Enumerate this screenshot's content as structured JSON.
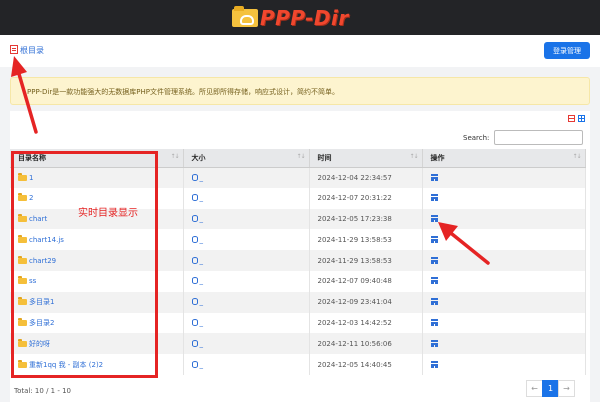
{
  "header": {
    "logo_text": "PPP-Dir",
    "logo_icon": "folder-cloud-icon"
  },
  "nav": {
    "home_label": "根目录",
    "home_icon": "home-icon",
    "login_label": "登录管理"
  },
  "notice": {
    "text": "PPP-Dir是一款功能强大的无数据库PHP文件管理系统。所见即所得存储，响应式设计，简约不简单。"
  },
  "search": {
    "label": "Search:",
    "value": ""
  },
  "table": {
    "columns": [
      "目录名称",
      "大小",
      "时间",
      "操作"
    ],
    "sort_glyph": "↑↓",
    "rows": [
      {
        "name": "1",
        "size": "_",
        "time": "2024-12-04 22:34:57"
      },
      {
        "name": "2",
        "size": "_",
        "time": "2024-12-07 20:31:22"
      },
      {
        "name": "chart",
        "size": "_",
        "time": "2024-12-05 17:23:38"
      },
      {
        "name": "chart14.js",
        "size": "_",
        "time": "2024-11-29 13:58:53"
      },
      {
        "name": "chart29",
        "size": "_",
        "time": "2024-11-29 13:58:53"
      },
      {
        "name": "ss",
        "size": "_",
        "time": "2024-12-07 09:40:48"
      },
      {
        "name": "多目录1",
        "size": "_",
        "time": "2024-12-09 23:41:04"
      },
      {
        "name": "多目录2",
        "size": "_",
        "time": "2024-12-03 14:42:52"
      },
      {
        "name": "好的呀",
        "size": "_",
        "time": "2024-12-11 10:56:06"
      },
      {
        "name": "重新1qq 我 - 副本 (2)2",
        "size": "_",
        "time": "2024-12-05 14:40:45"
      }
    ]
  },
  "footer": {
    "total": "Total: 10 / 1 - 10",
    "prev": "←",
    "page": "1",
    "next": "→"
  },
  "annotation": {
    "text": "实时目录显示",
    "color": "#e52424"
  },
  "colors": {
    "accent": "#1a73e8",
    "link": "#2f6fd6",
    "logo": "#f0472e",
    "annotation": "#e52424"
  }
}
